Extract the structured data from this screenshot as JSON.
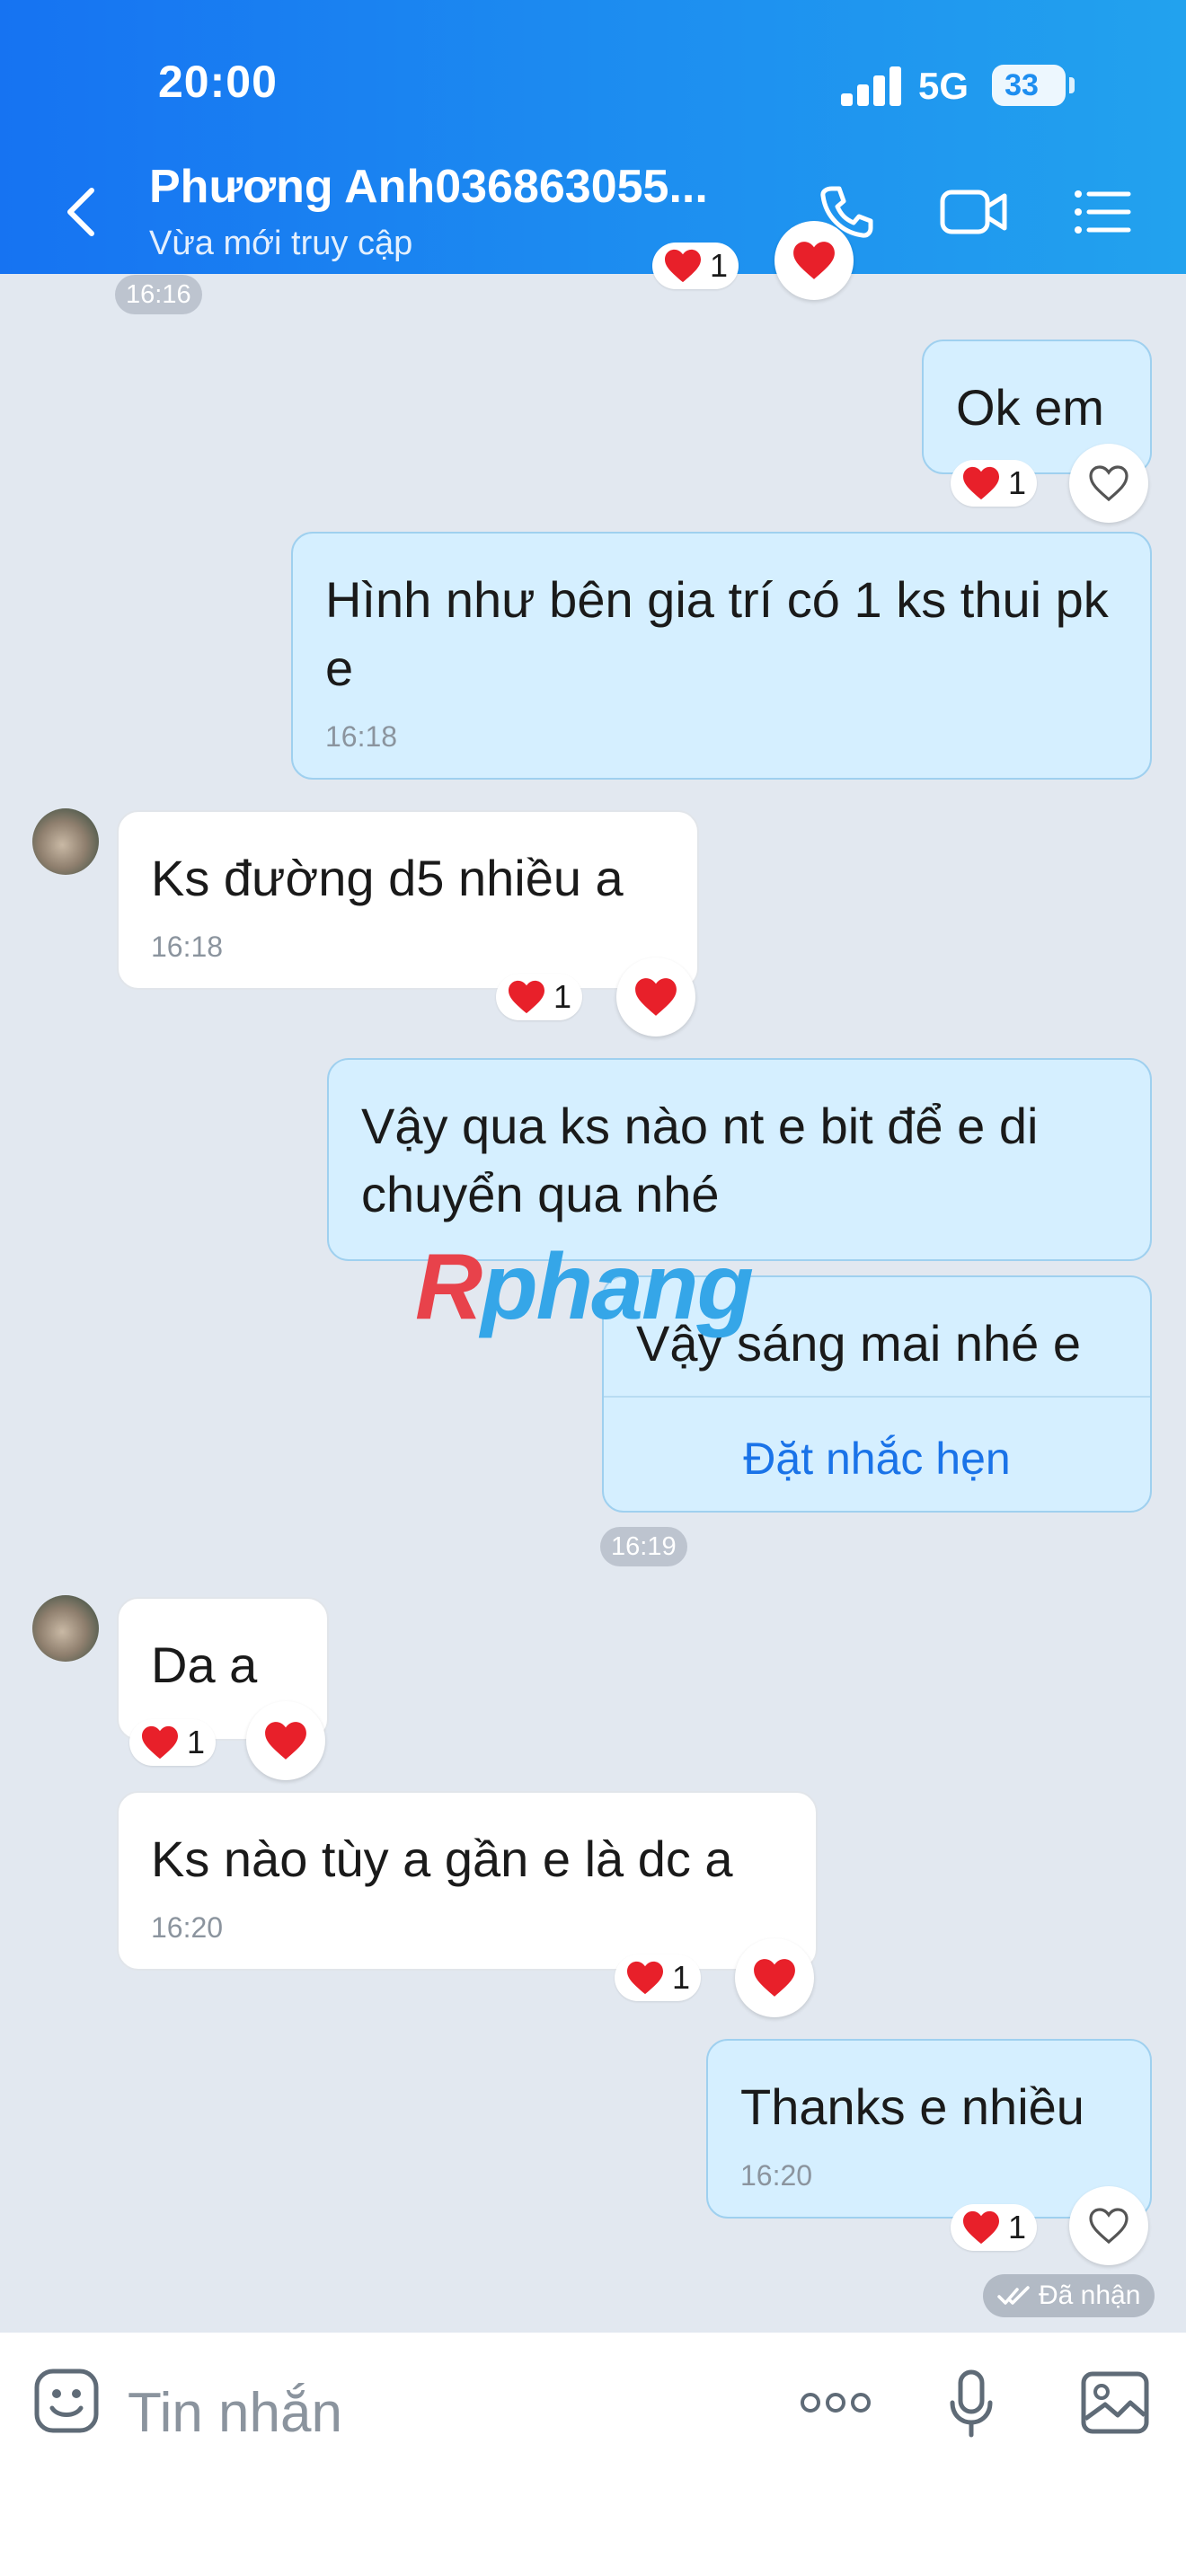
{
  "status_bar": {
    "time": "20:00",
    "network": "5G",
    "battery": "33"
  },
  "header": {
    "contact_name": "Phương Anh036863055...",
    "contact_status": "Vừa mới truy cập",
    "icons": [
      "back-icon",
      "phone-icon",
      "video-call-icon",
      "menu-icon"
    ]
  },
  "chat": {
    "partial_reaction_count": "1",
    "time_chip_top": "16:16",
    "messages": [
      {
        "dir": "out",
        "text": "Ok em",
        "reaction_count": "1"
      },
      {
        "dir": "out",
        "text": "Hình như bên gia trí có 1 ks thui pk e",
        "time": "16:18"
      },
      {
        "dir": "in",
        "text": "Ks đường d5 nhiều a",
        "time": "16:18",
        "reaction_count": "1"
      },
      {
        "dir": "out",
        "text": "Vậy qua ks nào nt e bit để e di chuyển qua nhé"
      },
      {
        "dir": "out",
        "text": "Vậy sáng mai nhé e",
        "action": "Đặt nhắc hẹn"
      },
      {
        "dir": "in",
        "text": "Da a",
        "reaction_count": "1"
      },
      {
        "dir": "in",
        "text": "Ks nào tùy a gần e là dc a",
        "time": "16:20",
        "reaction_count": "1"
      },
      {
        "dir": "out",
        "text": "Thanks e nhiều",
        "time": "16:20",
        "reaction_count": "1"
      }
    ],
    "time_chip_mid": "16:19",
    "seen_label": "Đã nhận",
    "watermark": {
      "r": "R",
      "rest": "phang"
    }
  },
  "input_bar": {
    "placeholder": "Tin nhắn",
    "icons": [
      "emoji-icon",
      "more-icon",
      "microphone-icon",
      "image-icon"
    ]
  },
  "colors": {
    "header_start": "#1673f2",
    "header_end": "#22a2ee",
    "out_bubble": "#d5efff",
    "in_bubble": "#ffffff",
    "heart": "#e8202a",
    "link": "#1a73e8"
  }
}
